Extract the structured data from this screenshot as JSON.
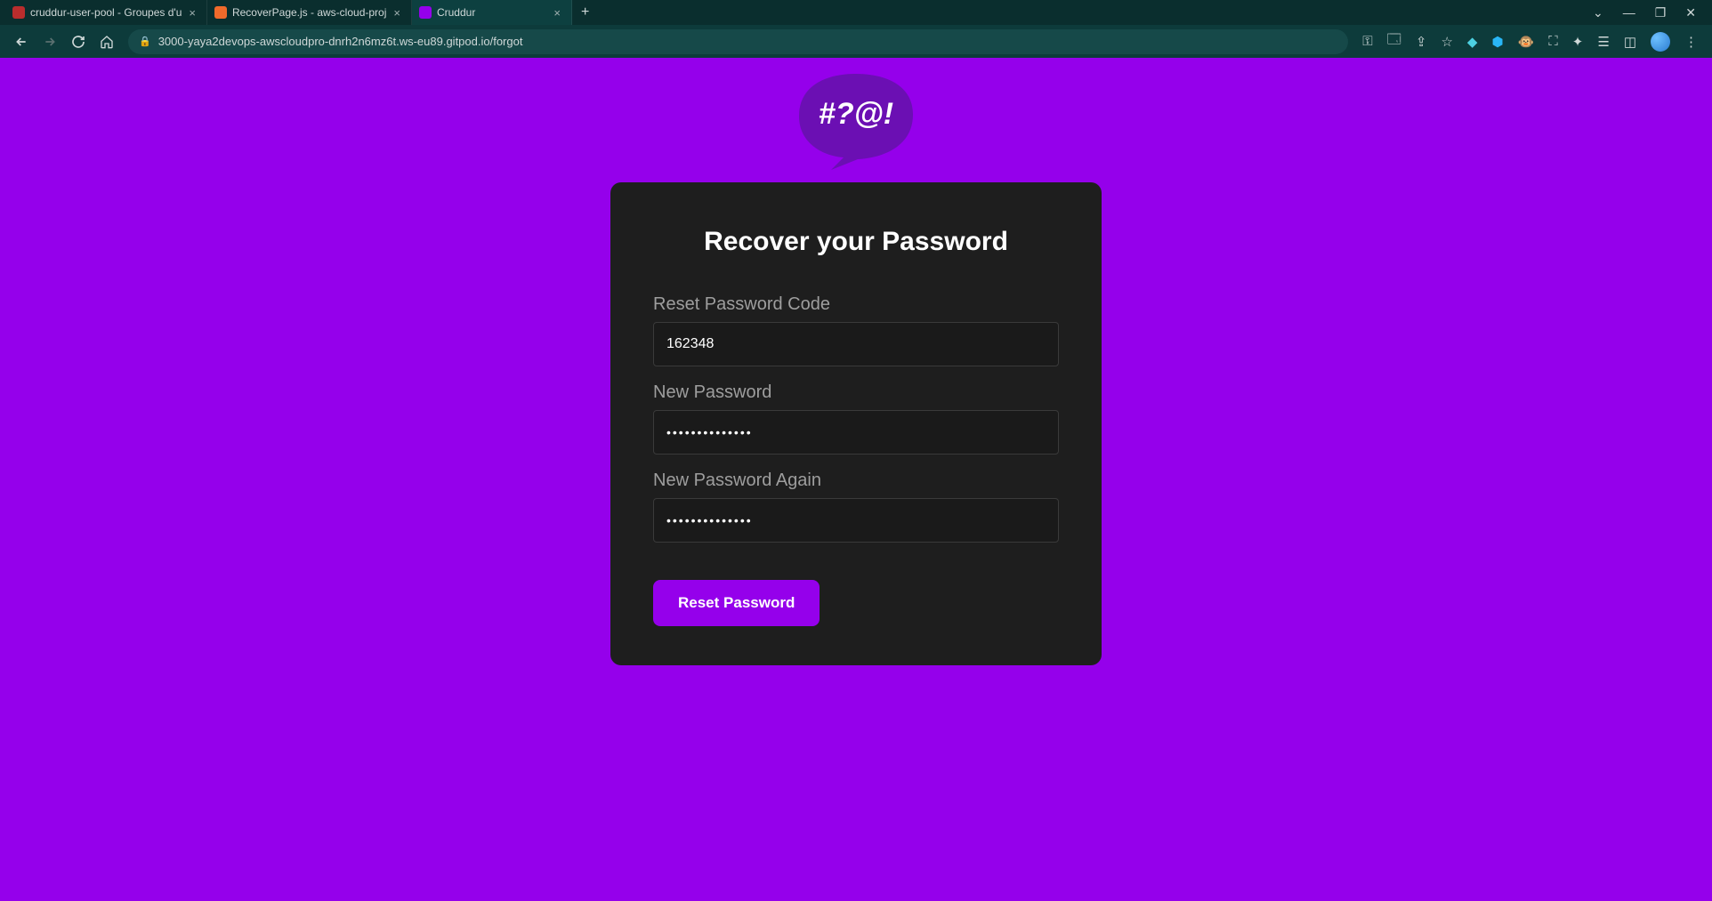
{
  "browser": {
    "tabs": [
      {
        "title": "cruddur-user-pool - Groupes d'u",
        "favicon_color": "#b92d2d"
      },
      {
        "title": "RecoverPage.js - aws-cloud-proj",
        "favicon_color": "#f06a2b"
      },
      {
        "title": "Cruddur",
        "favicon_color": "#9500eb",
        "active": true
      }
    ],
    "url": "3000-yaya2devops-awscloudpro-dnrh2n6mz6t.ws-eu89.gitpod.io/forgot"
  },
  "logo_text": "#?@!",
  "form": {
    "heading": "Recover your Password",
    "code_label": "Reset Password Code",
    "code_value": "162348",
    "password_label": "New Password",
    "password_value": "••••••••••••••",
    "password2_label": "New Password Again",
    "password2_value": "••••••••••••••",
    "submit_label": "Reset Password"
  }
}
